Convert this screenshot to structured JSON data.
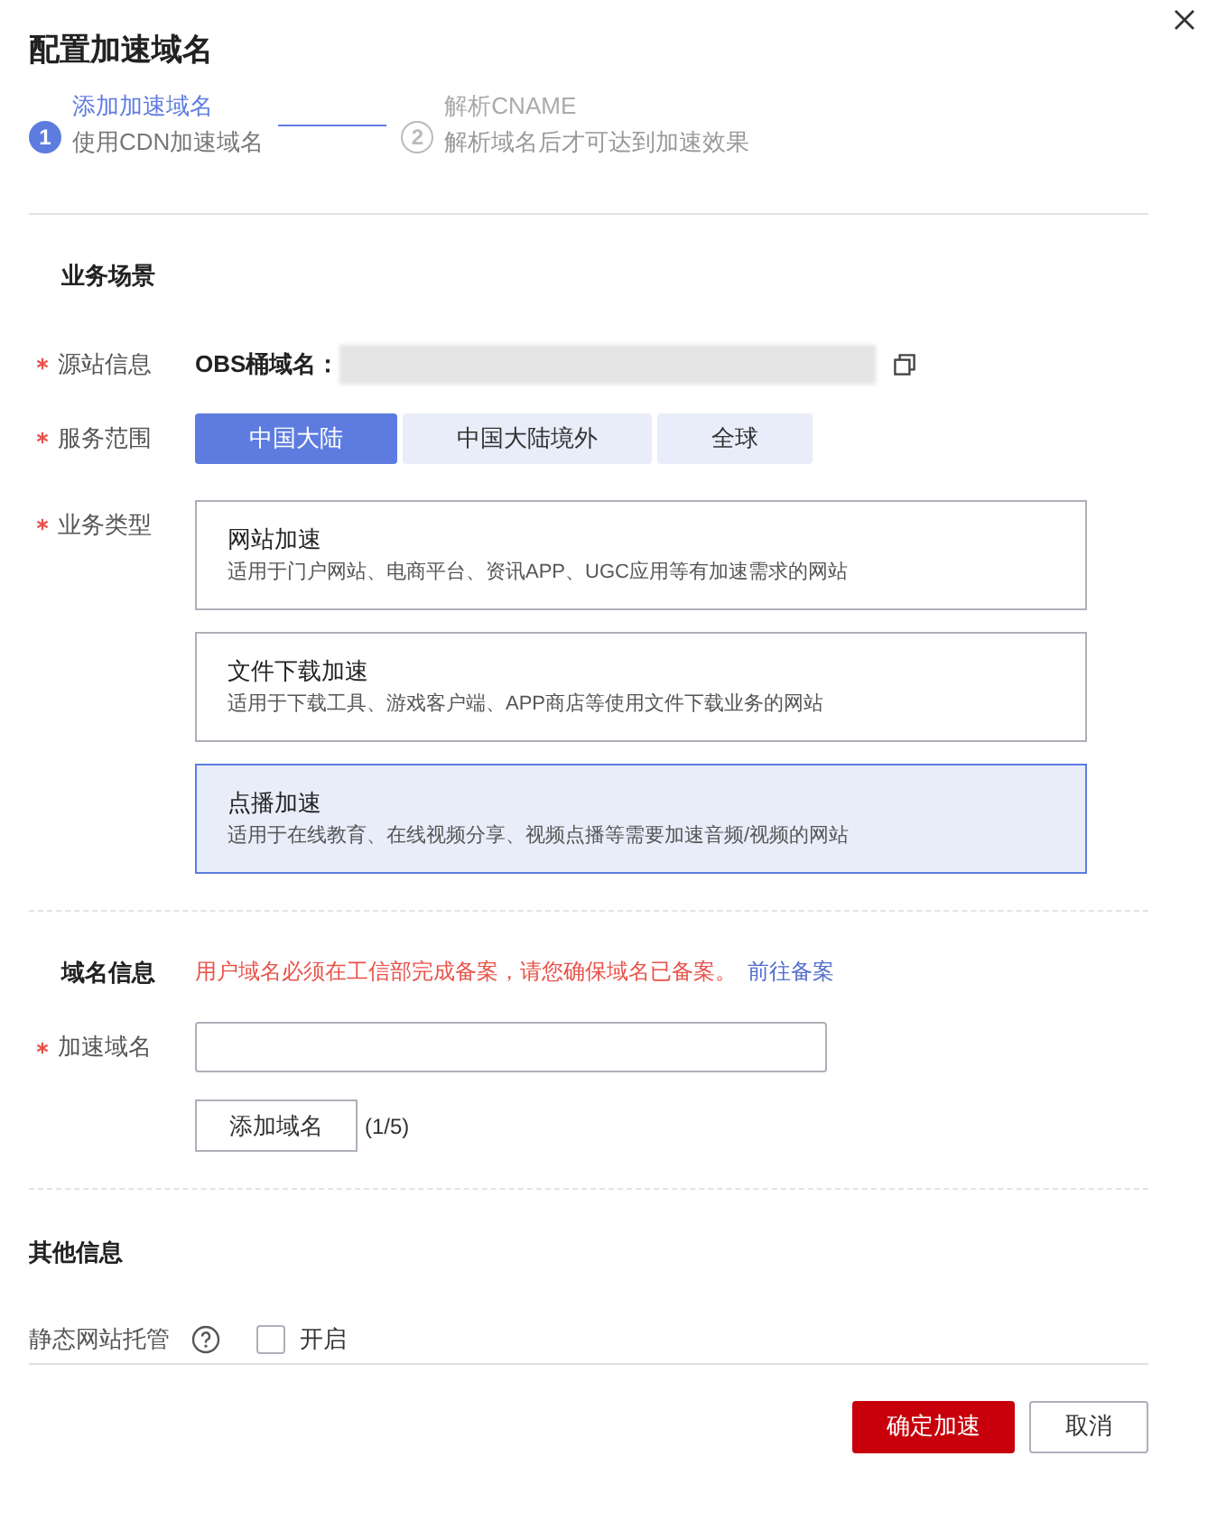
{
  "dialog": {
    "title": "配置加速域名"
  },
  "steps": [
    {
      "number": "1",
      "title": "添加加速域名",
      "description": "使用CDN加速域名",
      "selected": true
    },
    {
      "number": "2",
      "title": "解析CNAME",
      "description": "解析域名后才可达到加速效果",
      "selected": false
    }
  ],
  "business": {
    "title": "业务场景",
    "origin": {
      "label": "源站信息",
      "required": true,
      "value_label": "OBS桶域名："
    },
    "scope": {
      "label": "服务范围",
      "required": true,
      "options": [
        {
          "label": "中国大陆",
          "selected": true
        },
        {
          "label": "中国大陆境外",
          "selected": false
        },
        {
          "label": "全球",
          "selected": false
        }
      ]
    },
    "type": {
      "label": "业务类型",
      "required": true,
      "options": [
        {
          "title": "网站加速",
          "description": "适用于门户网站、电商平台、资讯APP、UGC应用等有加速需求的网站",
          "selected": false
        },
        {
          "title": "文件下载加速",
          "description": "适用于下载工具、游戏客户端、APP商店等使用文件下载业务的网站",
          "selected": false
        },
        {
          "title": "点播加速",
          "description": "适用于在线教育、在线视频分享、视频点播等需要加速音频/视频的网站",
          "selected": true
        }
      ]
    }
  },
  "domain": {
    "title": "域名信息",
    "notice": "用户域名必须在工信部完成备案，请您确保域名已备案。",
    "link": "前往备案",
    "field": {
      "label": "加速域名",
      "required": true
    },
    "add_button": "添加域名",
    "count": "(1/5)"
  },
  "other": {
    "title": "其他信息",
    "hosting": {
      "label": "静态网站托管",
      "checkbox_label": "开启",
      "checked": false
    }
  },
  "buttons": [
    {
      "label": "确定加速",
      "kind": "primary"
    },
    {
      "label": "取消",
      "kind": "secondary"
    }
  ]
}
